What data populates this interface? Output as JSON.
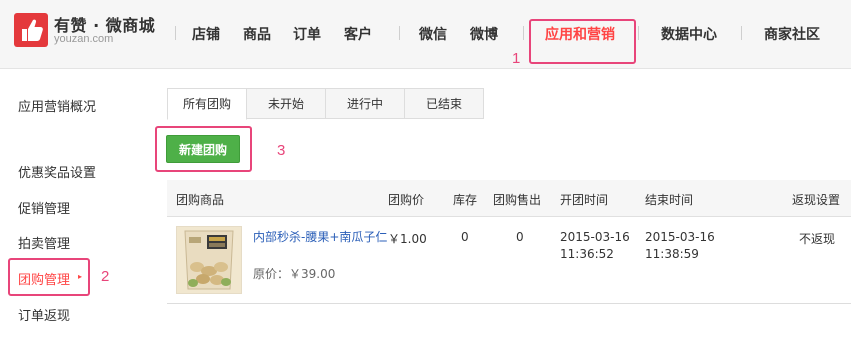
{
  "brand": {
    "name": "有赞 · 微商城",
    "domain": "youzan.com",
    "accent": "#ff4444",
    "logo_color": "#e4393c"
  },
  "nav": {
    "items": [
      "店铺",
      "商品",
      "订单",
      "客户",
      "微信",
      "微博",
      "应用和营销",
      "数据中心",
      "商家社区"
    ],
    "active": "应用和营销"
  },
  "annotations": {
    "step1": "1",
    "step2": "2",
    "step3": "3",
    "color": "#e8457a"
  },
  "sidebar": {
    "items": [
      "应用营销概况",
      "优惠奖品设置",
      "促销管理",
      "拍卖管理",
      "团购管理",
      "订单返现"
    ],
    "active": "团购管理",
    "arrow": "▸"
  },
  "tabs": [
    "所有团购",
    "未开始",
    "进行中",
    "已结束"
  ],
  "create_button": {
    "label": "新建团购",
    "color": "#4eb048"
  },
  "table": {
    "headers": [
      "团购商品",
      "团购价",
      "库存",
      "团购售出",
      "开团时间",
      "结束时间",
      "返现设置"
    ],
    "rows": [
      {
        "product": "内部秒杀-腰果+南瓜子仁",
        "original_price_label": "原价：￥39.00",
        "price": "￥1.00",
        "stock": "0",
        "sold": "0",
        "start_date": "2015-03-16",
        "start_time": "11:36:52",
        "end_date": "2015-03-16",
        "end_time": "11:38:59",
        "cashback": "不返现"
      }
    ]
  }
}
